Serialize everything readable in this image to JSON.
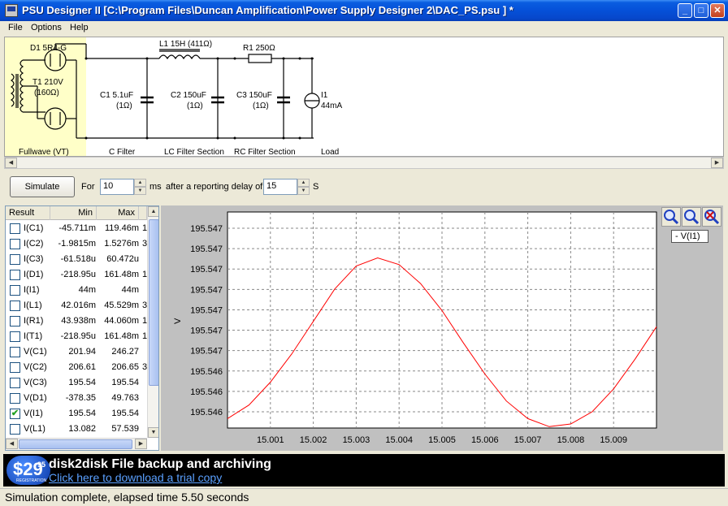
{
  "window": {
    "title": "PSU Designer II  [C:\\Program Files\\Duncan Amplification\\Power Supply Designer 2\\DAC_PS.psu ] *"
  },
  "menu": {
    "file": "File",
    "options": "Options",
    "help": "Help"
  },
  "schematic": {
    "rectifier": {
      "name": "D1 5R4-G",
      "transformer": "T1 210V",
      "impedance": "(160Ω)",
      "section": "Fullwave (VT)"
    },
    "c_filter": {
      "label": "C1 5.1uF",
      "esr": "(1Ω)",
      "section": "C Filter"
    },
    "lc_filter": {
      "inductor": "L1 15H (411Ω)",
      "cap": "C2 150uF",
      "esr": "(1Ω)",
      "section": "LC Filter Section"
    },
    "rc_filter": {
      "resistor": "R1 250Ω",
      "cap": "C3 150uF",
      "esr": "(1Ω)",
      "section": "RC Filter Section"
    },
    "load": {
      "name": "I1",
      "value": "44mA",
      "section": "Load"
    }
  },
  "controls": {
    "simulate_label": "Simulate",
    "for_label": "For",
    "duration_value": "10",
    "ms_label": "ms",
    "delay_label": "after a reporting delay of",
    "delay_value": "15",
    "s_label": "S"
  },
  "results": {
    "headers": {
      "result": "Result",
      "min": "Min",
      "max": "Max"
    },
    "rows": [
      {
        "name": "I(C1)",
        "min": "-45.711m",
        "max": "119.46m",
        "extra": "1",
        "checked": false
      },
      {
        "name": "I(C2)",
        "min": "-1.9815m",
        "max": "1.5276m",
        "extra": "3",
        "checked": false
      },
      {
        "name": "I(C3)",
        "min": "-61.518u",
        "max": "60.472u",
        "extra": "",
        "checked": false
      },
      {
        "name": "I(D1)",
        "min": "-218.95u",
        "max": "161.48m",
        "extra": "1",
        "checked": false
      },
      {
        "name": "I(I1)",
        "min": "44m",
        "max": "44m",
        "extra": "",
        "checked": false
      },
      {
        "name": "I(L1)",
        "min": "42.016m",
        "max": "45.529m",
        "extra": "3",
        "checked": false
      },
      {
        "name": "I(R1)",
        "min": "43.938m",
        "max": "44.060m",
        "extra": "1",
        "checked": false
      },
      {
        "name": "I(T1)",
        "min": "-218.95u",
        "max": "161.48m",
        "extra": "1",
        "checked": false
      },
      {
        "name": "V(C1)",
        "min": "201.94",
        "max": "246.27",
        "extra": "",
        "checked": false
      },
      {
        "name": "V(C2)",
        "min": "206.61",
        "max": "206.65",
        "extra": "3",
        "checked": false
      },
      {
        "name": "V(C3)",
        "min": "195.54",
        "max": "195.54",
        "extra": "",
        "checked": false
      },
      {
        "name": "V(D1)",
        "min": "-378.35",
        "max": "49.763",
        "extra": "",
        "checked": false
      },
      {
        "name": "V(I1)",
        "min": "195.54",
        "max": "195.54",
        "extra": "",
        "checked": true
      },
      {
        "name": "V(L1)",
        "min": "13.082",
        "max": "57.539",
        "extra": "",
        "checked": false
      }
    ]
  },
  "chart_data": {
    "type": "line",
    "title": "",
    "xlabel": "",
    "ylabel": "V",
    "xlim": [
      15.0,
      15.01
    ],
    "ylim": [
      195.5459,
      195.5475
    ],
    "x_ticks": [
      "15.001",
      "15.002",
      "15.003",
      "15.004",
      "15.005",
      "15.006",
      "15.007",
      "15.008",
      "15.009"
    ],
    "y_ticks": [
      "195.547",
      "195.547",
      "195.547",
      "195.547",
      "195.547",
      "195.547",
      "195.547",
      "195.546",
      "195.546",
      "195.546"
    ],
    "grid": true,
    "series": [
      {
        "name": "V(I1)",
        "color": "#ff0000",
        "x": [
          15.0,
          15.0005,
          15.001,
          15.0015,
          15.002,
          15.0025,
          15.003,
          15.0035,
          15.004,
          15.0045,
          15.005,
          15.0055,
          15.006,
          15.0065,
          15.007,
          15.0075,
          15.008,
          15.0085,
          15.009,
          15.0095,
          15.01
        ],
        "y": [
          195.54597,
          195.54607,
          195.54624,
          195.54645,
          195.54669,
          195.54693,
          195.5471,
          195.54716,
          195.54711,
          195.54697,
          195.54677,
          195.54653,
          195.5463,
          195.5461,
          195.54597,
          195.54591,
          195.54593,
          195.54602,
          195.54619,
          195.54641,
          195.54665
        ]
      }
    ],
    "legend": {
      "label": "- V(I1)",
      "position": "top-right"
    }
  },
  "banner": {
    "price": "$29",
    "cents": "95",
    "price_note": "REGISTRATION",
    "title": "disk2disk File backup and archiving",
    "link": "Click here to download a trial copy"
  },
  "status": {
    "text": "Simulation complete, elapsed time 5.50 seconds"
  }
}
